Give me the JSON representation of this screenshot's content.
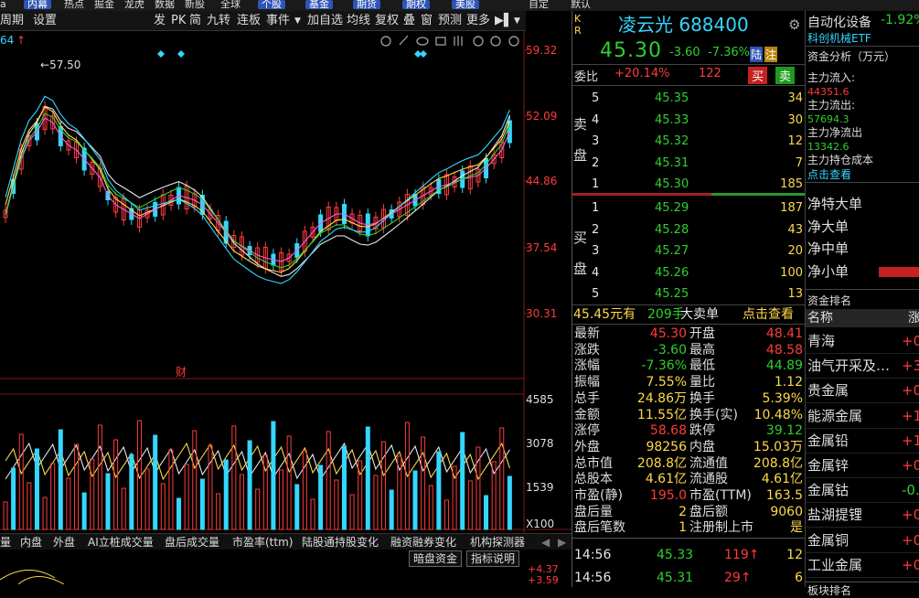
{
  "top_tabs": [
    "内幕",
    "热点",
    "掘金",
    "龙虎",
    "数据",
    "新股",
    "全球",
    "个股",
    "基金",
    "期货",
    "期权",
    "美股",
    "自定",
    "默认"
  ],
  "toolbar": {
    "period": "周期",
    "settings": "设置",
    "items": [
      "发",
      "PK",
      "简",
      "九转",
      "连板",
      "事件"
    ],
    "items2": [
      "加自选",
      "均线",
      "复权",
      "叠",
      "窗",
      "预测",
      "更多"
    ]
  },
  "chart": {
    "ma_label": "64",
    "high_label": "57.50",
    "y_ticks": [
      "59.32",
      "52.09",
      "44.86",
      "37.54",
      "30.31"
    ],
    "vol_ticks": [
      "4585",
      "3078",
      "1539"
    ],
    "vol_unit": "X100",
    "fin_marker": "财",
    "ind_ticks": [
      "+4.37",
      "+3.59"
    ],
    "bottom_tabs": [
      "内盘",
      "外盘",
      "AI立桩成交量",
      "盘后成交量",
      "市盈率(ttm)",
      "陆股通持股变化",
      "融资融券变化",
      "机构探测器"
    ],
    "bottom_first": "量",
    "btn_a": "暗盘资金",
    "btn_b": "指标说明"
  },
  "stock": {
    "flag1": "K",
    "flag2": "R",
    "name": "凌云光",
    "code": "688400",
    "price": "45.30",
    "change": "-3.60",
    "pct": "-7.36%",
    "tag1": "陆",
    "tag2": "注",
    "wb_label": "委比",
    "wb_value": "+20.14%",
    "wb_num": "122",
    "buy_btn": "买",
    "sell_btn": "卖",
    "sell_side": "卖盘",
    "buy_side": "买盘",
    "asks": [
      {
        "lvl": "5",
        "p": "45.35",
        "v": "34"
      },
      {
        "lvl": "4",
        "p": "45.33",
        "v": "30"
      },
      {
        "lvl": "3",
        "p": "45.32",
        "v": "12"
      },
      {
        "lvl": "2",
        "p": "45.31",
        "v": "7"
      },
      {
        "lvl": "1",
        "p": "45.30",
        "v": "185"
      }
    ],
    "bids": [
      {
        "lvl": "1",
        "p": "45.29",
        "v": "187"
      },
      {
        "lvl": "2",
        "p": "45.28",
        "v": "43"
      },
      {
        "lvl": "3",
        "p": "45.27",
        "v": "20"
      },
      {
        "lvl": "4",
        "p": "45.26",
        "v": "100"
      },
      {
        "lvl": "5",
        "p": "45.25",
        "v": "13"
      }
    ],
    "big_price": "45.45元有",
    "big_vol": "209手",
    "big_label": "大卖单",
    "big_link": "点击查看",
    "stats": [
      [
        "最新",
        "45.30",
        "开盘",
        "48.41"
      ],
      [
        "涨跌",
        "-3.60",
        "最高",
        "48.58"
      ],
      [
        "涨幅",
        "-7.36%",
        "最低",
        "44.89"
      ],
      [
        "振幅",
        "7.55%",
        "量比",
        "1.12"
      ],
      [
        "总手",
        "24.86万",
        "换手",
        "5.39%"
      ],
      [
        "金额",
        "11.55亿",
        "换手(实)",
        "10.48%"
      ],
      [
        "涨停",
        "58.68",
        "跌停",
        "39.12"
      ],
      [
        "外盘",
        "98256",
        "内盘",
        "15.03万"
      ],
      [
        "总市值",
        "208.8亿",
        "流通值",
        "208.8亿"
      ],
      [
        "总股本",
        "4.61亿",
        "流通股",
        "4.61亿"
      ],
      [
        "市盈(静)",
        "195.0",
        "市盈(TTM)",
        "163.5"
      ],
      [
        "盘后量",
        "2",
        "盘后额",
        "9060"
      ],
      [
        "盘后笔数",
        "1",
        "注册制上市",
        "是"
      ]
    ],
    "ticks": [
      [
        "14:56",
        "45.33",
        "119",
        "12"
      ],
      [
        "14:56",
        "45.31",
        "29",
        "6"
      ]
    ]
  },
  "sector": {
    "name": "自动化设备",
    "pct": "-1.92%",
    "etf": "科创机械ETF",
    "flow_title": "资金分析（万元）",
    "flows": [
      [
        "主力流入:",
        "44351.6"
      ],
      [
        "主力流出:",
        "57694.3"
      ],
      [
        "主力净流出",
        "13342.6"
      ],
      [
        "主力持仓成本",
        ""
      ]
    ],
    "flow_link": "点击查看",
    "net": [
      "净特大单",
      "净大单",
      "净中单",
      "净小单"
    ],
    "rank_title": "资金排名",
    "rank_head": "名称",
    "rank_head2": "涨",
    "ranks": [
      [
        "青海",
        "+0."
      ],
      [
        "油气开采及…",
        "+3."
      ],
      [
        "贵金属",
        "+0."
      ],
      [
        "能源金属",
        "+1."
      ],
      [
        "金属铅",
        "+1."
      ],
      [
        "金属锌",
        "+0."
      ],
      [
        "金属钴",
        "-0."
      ],
      [
        "盐湖提锂",
        "+0."
      ],
      [
        "金属铜",
        "+0."
      ],
      [
        "工业金属",
        "+0."
      ]
    ],
    "bottom": "板块排名"
  }
}
